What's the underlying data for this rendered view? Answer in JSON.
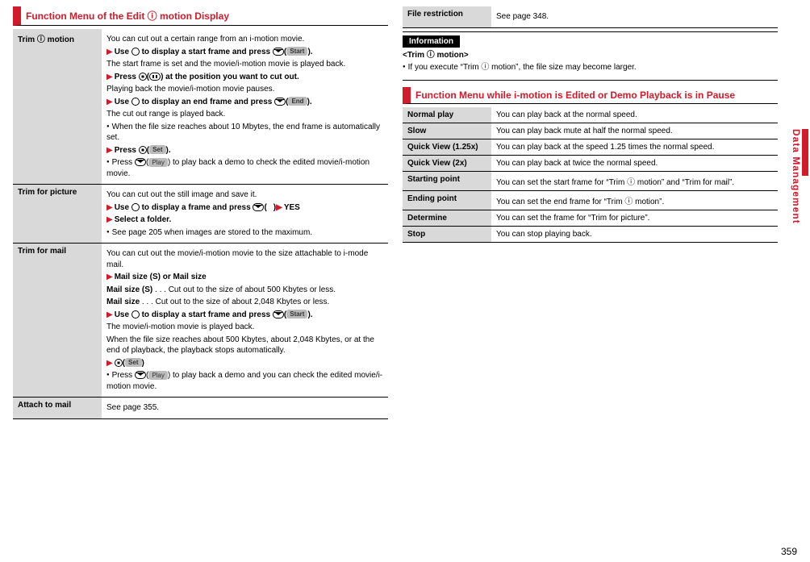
{
  "page_number": "359",
  "side_tab": "Data Management",
  "left": {
    "heading": "Function Menu of the Edit ⓘ motion Display",
    "rows": [
      {
        "label": "Trim ⓘ motion",
        "body": [
          {
            "text": "You can cut out a certain range from an i-motion movie."
          },
          {
            "tri": true,
            "bold": true,
            "text": "Use ",
            "afterBtn1": " to display a start frame and press ",
            "pill": "Start",
            "trail": ")."
          },
          {
            "text": "The start frame is set and the movie/i-motion movie is played back."
          },
          {
            "tri": true,
            "bold": true,
            "text": "Press ",
            "pillPre": "(",
            "pill": "pause-icon",
            "trail": ") at the position you want to cut out."
          },
          {
            "text": "Playing back the movie/i-motion movie pauses."
          },
          {
            "tri": true,
            "bold": true,
            "text": "Use ",
            "afterBtn1": " to display an end frame and press ",
            "pill": "End",
            "trail": ")."
          },
          {
            "text": "The cut out range is played back."
          },
          {
            "bul": true,
            "text": "When the file size reaches about 10 Mbytes, the end frame is automatically set."
          },
          {
            "tri": true,
            "bold": true,
            "text": "Press ",
            "pill": "Set",
            "trail": ")."
          },
          {
            "bul": true,
            "text": "Press ",
            "pill": "Play",
            "trail2": ") to play back a demo to check the edited movie/i-motion movie."
          }
        ]
      },
      {
        "label": "Trim for picture",
        "body": [
          {
            "text": "You can cut out the still image and save it."
          },
          {
            "tri": true,
            "bold": true,
            "text": "Use ",
            "afterBtn1": " to display a frame and press ",
            "pill": "",
            "trail": ")",
            "tri2": "YES"
          },
          {
            "tri": true,
            "bold": true,
            "text": "Select a folder."
          },
          {
            "bul": true,
            "text": "See page 205 when images are stored to the maximum."
          }
        ]
      },
      {
        "label": "Trim for mail",
        "body": [
          {
            "text": "You can cut out the movie/i-motion movie to the size attachable to i-mode mail."
          },
          {
            "tri": true,
            "bold": true,
            "text": "Mail size (S) or Mail size"
          },
          {
            "label2": "Mail size (S)",
            "desc": "Cut out to the size of about 500 Kbytes or less."
          },
          {
            "label2": "Mail size",
            "desc": "Cut out to the size of about 2,048 Kbytes or less."
          },
          {
            "tri": true,
            "bold": true,
            "text": "Use ",
            "afterBtn1": " to display a start frame and press ",
            "pill": "Start",
            "trail": ")."
          },
          {
            "text": "The movie/i-motion movie is played back."
          },
          {
            "text": "When the file size reaches about 500 Kbytes, about 2,048 Kbytes, or at the end of playback, the playback stops automatically."
          },
          {
            "tri": true,
            "bold": true,
            "btnOnly": true,
            "pill": "Set",
            "trail": ")"
          },
          {
            "bul": true,
            "text": "Press ",
            "pill": "Play",
            "trail2": ") to play back a demo and you can check the edited movie/i-motion movie."
          }
        ]
      },
      {
        "label": "Attach to mail",
        "body": [
          {
            "text": "See page 355."
          }
        ]
      }
    ]
  },
  "right": {
    "rows_top": [
      {
        "label": "File restriction",
        "body": [
          {
            "text": "See page 348."
          }
        ]
      }
    ],
    "info": {
      "tag": "Information",
      "title": "<Trim ⓘ motion>",
      "line": "If you execute “Trim ⓘ motion”, the file size may become larger."
    },
    "heading": "Function Menu while i-motion is Edited or Demo Playback is in Pause",
    "rows": [
      {
        "label": "Normal play",
        "text": "You can play back at the normal speed."
      },
      {
        "label": "Slow",
        "text": "You can play back mute at half the normal speed."
      },
      {
        "label": "Quick View (1.25x)",
        "text": "You can play back at the speed 1.25 times the normal speed."
      },
      {
        "label": "Quick View (2x)",
        "text": "You can play back at twice the normal speed."
      },
      {
        "label": "Starting point",
        "text": "You can set the start frame for “Trim ⓘ motion” and “Trim for mail”."
      },
      {
        "label": "Ending point",
        "text": "You can set the end frame for “Trim ⓘ motion”."
      },
      {
        "label": "Determine",
        "text": "You can set the frame for “Trim for picture”."
      },
      {
        "label": "Stop",
        "text": "You can stop playing back."
      }
    ]
  }
}
